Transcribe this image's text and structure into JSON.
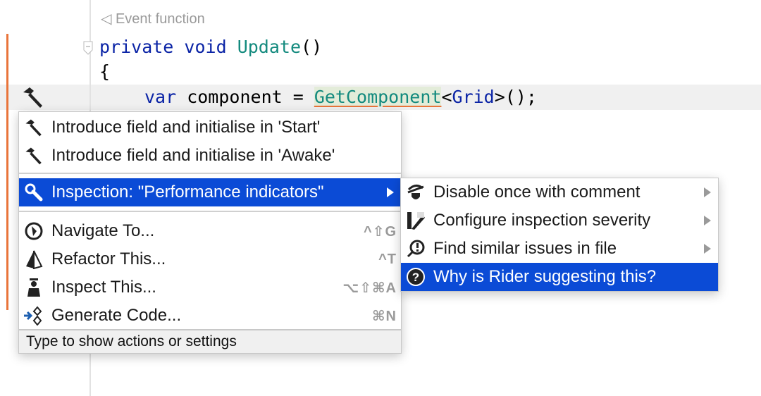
{
  "editor": {
    "hint": "Event function",
    "line1": {
      "kw1": "private",
      "kw2": "void",
      "fn": "Update",
      "rest": "()"
    },
    "line2": "{",
    "line3": {
      "kw": "var",
      "mid": " component = ",
      "call": "GetComponent",
      "lt": "<",
      "type": "Grid",
      "end": ">();"
    }
  },
  "menu": {
    "items": [
      {
        "label": "Introduce field and initialise in 'Start'",
        "icon": "hammer-icon"
      },
      {
        "label": "Introduce field and initialise in 'Awake'",
        "icon": "hammer-icon"
      },
      {
        "label": "Inspection: \"Performance indicators\"",
        "icon": "wrench-icon",
        "selected": true
      },
      {
        "label": "Navigate To...",
        "icon": "compass-icon",
        "shortcut": "^⇧G"
      },
      {
        "label": "Refactor This...",
        "icon": "refactor-icon",
        "shortcut": "^T"
      },
      {
        "label": "Inspect This...",
        "icon": "inspector-icon",
        "shortcut": "⌥⇧⌘A"
      },
      {
        "label": "Generate Code...",
        "icon": "generate-icon",
        "shortcut": "⌘N"
      }
    ],
    "footer": "Type to show actions or settings"
  },
  "submenu": {
    "items": [
      {
        "label": "Disable once with comment",
        "icon": "disable-icon"
      },
      {
        "label": "Configure inspection severity",
        "icon": "severity-icon"
      },
      {
        "label": "Find similar issues in file",
        "icon": "find-issues-icon"
      },
      {
        "label": "Why is Rider suggesting this?",
        "icon": "question-icon",
        "selected": true
      }
    ]
  },
  "colors": {
    "selection": "#0b4bd6",
    "change_bar": "#e9743a",
    "keyword": "#0b24a6",
    "method": "#138a7e"
  }
}
